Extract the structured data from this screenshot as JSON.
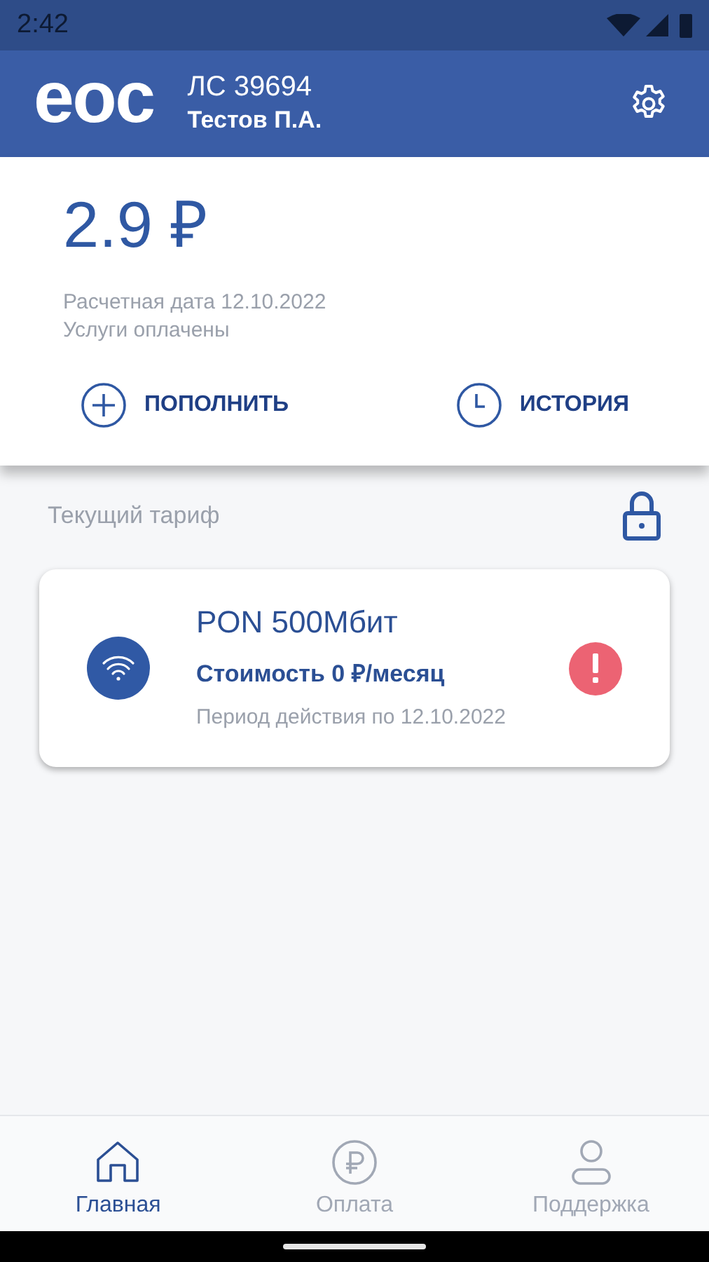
{
  "status_bar": {
    "time": "2:42"
  },
  "header": {
    "logo": "eoc",
    "account": "ЛС 39694",
    "user": "Тестов П.А."
  },
  "balance": {
    "amount": "2.9 ₽",
    "billing_date": "Расчетная дата 12.10.2022",
    "status": "Услуги оплачены"
  },
  "actions": [
    {
      "kind": "topup",
      "label": "ПОПОЛНИТЬ"
    },
    {
      "kind": "history",
      "label": "ИСТОРИЯ"
    }
  ],
  "tariff": {
    "heading": "Текущий тариф",
    "locked": true,
    "name": "PON 500Мбит",
    "price": "Стоимость 0 ₽/месяц",
    "period": "Период действия по 12.10.2022",
    "warning": true
  },
  "nav": [
    {
      "kind": "home",
      "label": "Главная",
      "selected": true
    },
    {
      "kind": "payment",
      "label": "Оплата",
      "selected": false
    },
    {
      "kind": "support",
      "label": "Поддержка",
      "selected": false
    }
  ]
}
